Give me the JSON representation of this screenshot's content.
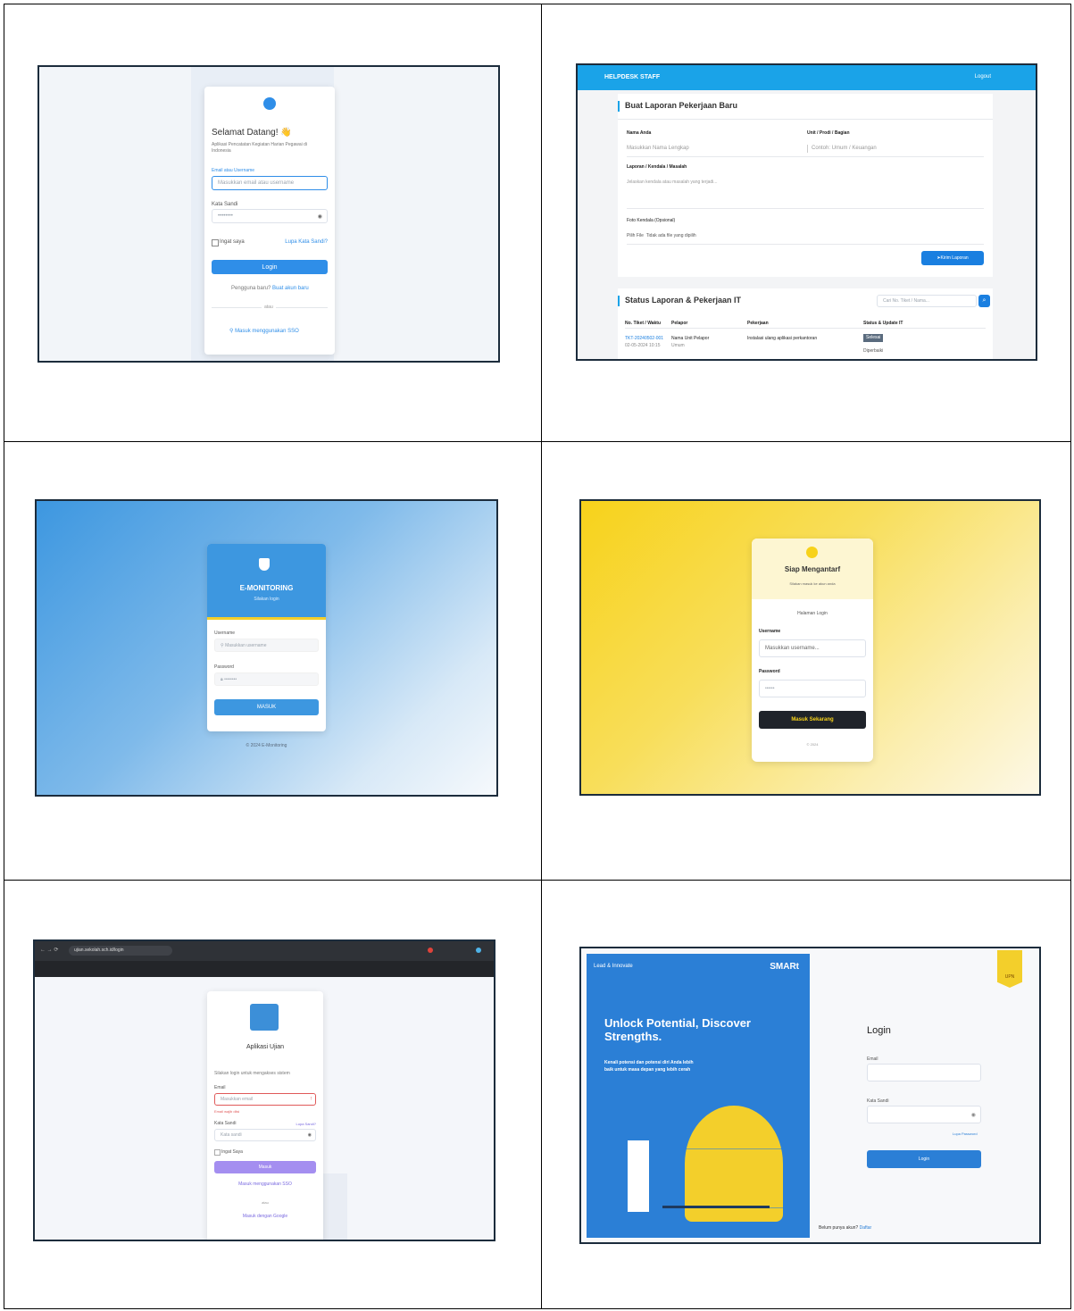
{
  "p1": {
    "title": "Selamat Datang! 👋",
    "subtitle": "Aplikasi Pencatatan Kegiatan Harian Pegawai di Indonesia",
    "user_label": "Email atau Username",
    "user_placeholder": "Masukkan email atau username",
    "pass_label": "Kata Sandi",
    "pass_placeholder": "••••••••",
    "remember": "Ingat saya",
    "forgot": "Lupa Kata Sandi?",
    "login": "Login",
    "new_user_prefix": "Pengguna baru?",
    "new_user_link": "Buat akun baru",
    "or": "atau",
    "sso": "Masuk menggunakan SSO",
    "accent": "#2f8ee8"
  },
  "p2": {
    "header": "HELPDESK STAFF",
    "logout": "Logout",
    "form_title": "Buat Laporan Pekerjaan Baru",
    "name_label": "Nama Anda",
    "name_placeholder": "Masukkan Nama Lengkap",
    "unit_label": "Unit / Prodi / Bagian",
    "unit_placeholder": "Contoh: Umum / Keuangan",
    "desc_label": "Laporan / Kendala / Masalah",
    "desc_placeholder": "Jelaskan kendala atau masalah yang terjadi...",
    "file_label": "Foto Kendala (Opsional)",
    "file_button": "Pilih File",
    "file_text": "Tidak ada file yang dipilih",
    "submit": "Kirim Laporan",
    "status_title": "Status Laporan & Pekerjaan IT",
    "search_placeholder": "Cari No. Tiket / Nama...",
    "columns": [
      "No. Tiket / Waktu",
      "Pelapor",
      "Pekerjaan",
      "Status & Update IT"
    ],
    "row": [
      "TKT-20240502-001",
      "Nama Unit Pelapor",
      "Instalasi ulang aplikasi perkantoran",
      "Selesai"
    ],
    "row_sub": [
      "02-05-2024 10:15",
      "Umum",
      "",
      "Diperbaiki"
    ],
    "accent": "#1aa3e8"
  },
  "p3": {
    "title": "E-MONITORING",
    "subtitle": "Silakan login",
    "user_label": "Username",
    "user_placeholder": "Masukkan username",
    "pass_label": "Password",
    "pass_placeholder": "••••••••",
    "login": "MASUK",
    "footer": "© 2024 E-Monitoring",
    "accent": "#3d97e0"
  },
  "p4": {
    "title": "Siap Mengantarf",
    "subtitle": "Silakan masuk ke akun anda",
    "section": "Halaman Login",
    "user_label": "Username",
    "user_placeholder": "Masukkan username...",
    "pass_label": "Password",
    "pass_placeholder": "••••••",
    "login": "Masuk Sekarang",
    "footer": "© 2024",
    "accent": "#f7d21a"
  },
  "p5": {
    "url": "ujian.sekolah.sch.id/login",
    "title": "Aplikasi Ujian",
    "intro": "Silakan login untuk mengakses sistem",
    "email_label": "Email",
    "email_placeholder": "Masukkan email",
    "email_error": "Email wajib diisi",
    "pass_label": "Kata Sandi",
    "forgot": "Lupa Sandi?",
    "pass_placeholder": "Kata sandi",
    "remember": "Ingat Saya",
    "login": "Masuk",
    "alt_link": "Masuk menggunakan SSO",
    "or": "atau",
    "footer_link": "Masuk dengan Google",
    "accent": "#a48ef0"
  },
  "p6": {
    "brand_left": "Lead & Innovate",
    "brand_right": "SMARt",
    "headline": "Unlock Potential, Discover Strengths.",
    "body": "Kenali potensi dan potensi diri Anda lebih baik untuk masa depan yang lebih cerah",
    "title": "Login",
    "email_label": "Email",
    "pass_label": "Kata Sandi",
    "forgot": "Lupa Password",
    "login": "Login",
    "register_prefix": "Belum punya akun?",
    "register_link": "Daftar",
    "badge": "UPN",
    "accent": "#2b7fd6"
  }
}
